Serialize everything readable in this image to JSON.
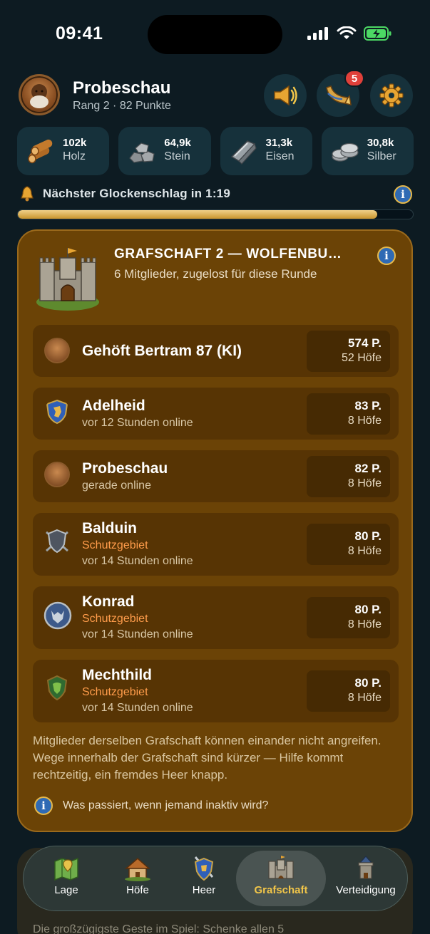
{
  "status": {
    "time": "09:41"
  },
  "player": {
    "name": "Probeschau",
    "subtitle": "Rang 2 · 82 Punkte"
  },
  "header_buttons": [
    {
      "icon": "horn-speaker-icon"
    },
    {
      "icon": "horn-icon",
      "badge": "5"
    },
    {
      "icon": "gear-icon"
    }
  ],
  "resources": [
    {
      "value": "102k",
      "label": "Holz",
      "icon": "wood-icon"
    },
    {
      "value": "64,9k",
      "label": "Stein",
      "icon": "stone-icon"
    },
    {
      "value": "31,3k",
      "label": "Eisen",
      "icon": "iron-icon"
    },
    {
      "value": "30,8k",
      "label": "Silber",
      "icon": "silver-icon"
    }
  ],
  "bell": {
    "text": "Nächster Glockenschlag in 1:19",
    "progress": 0.91
  },
  "county": {
    "title": "GRAFSCHAFT 2 — WOLFENBU…",
    "subtitle": "6 Mitglieder, zugelost für diese Runde",
    "members": [
      {
        "name": "Gehöft Bertram 87 (KI)",
        "protection": "",
        "online": "",
        "points": "574 P.",
        "farms": "52 Höfe",
        "avatar_color": "#8a4f22"
      },
      {
        "name": "Adelheid",
        "protection": "",
        "online": "vor 12 Stunden online",
        "points": "83 P.",
        "farms": "8 Höfe",
        "avatar_color": "#2f5fb8"
      },
      {
        "name": "Probeschau",
        "protection": "",
        "online": "gerade online",
        "points": "82 P.",
        "farms": "8 Höfe",
        "avatar_color": "#8a4f22"
      },
      {
        "name": "Balduin",
        "protection": "Schutzgebiet",
        "online": "vor 14 Stunden online",
        "points": "80 P.",
        "farms": "8 Höfe",
        "avatar_color": "#4e5560"
      },
      {
        "name": "Konrad",
        "protection": "Schutzgebiet",
        "online": "vor 14 Stunden online",
        "points": "80 P.",
        "farms": "8 Höfe",
        "avatar_color": "#3d5a8a"
      },
      {
        "name": "Mechthild",
        "protection": "Schutzgebiet",
        "online": "vor 14 Stunden online",
        "points": "80 P.",
        "farms": "8 Höfe",
        "avatar_color": "#2f6a30"
      }
    ],
    "note": "Mitglieder derselben Grafschaft können einander nicht angreifen. Wege innerhalb der Grafschaft sind kürzer — Hilfe kommt rechtzeitig, ein fremdes Heer knapp.",
    "question": "Was passiert, wenn jemand inaktiv wird?"
  },
  "behind_text": "Die großzügigste Geste im Spiel: Schenke allen 5",
  "tabs": [
    {
      "label": "Lage",
      "icon": "map-icon",
      "active": false
    },
    {
      "label": "Höfe",
      "icon": "farm-house-icon",
      "active": false
    },
    {
      "label": "Heer",
      "icon": "shield-sword-icon",
      "active": false
    },
    {
      "label": "Grafschaft",
      "icon": "castle-icon",
      "active": true
    },
    {
      "label": "Verteidigung",
      "icon": "tower-icon",
      "active": false
    }
  ],
  "colors": {
    "accent": "#f2c649",
    "panel": "#6b4306",
    "protection": "#ff9c4b",
    "badge": "#e0403a"
  }
}
